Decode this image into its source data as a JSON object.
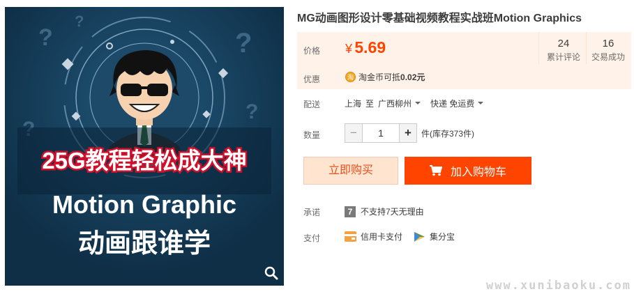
{
  "product": {
    "title": "MG动画图形设计零基础视频教程实战班Motion Graphics",
    "image": {
      "banner_text": "25G教程轻松成大神",
      "headline": "Motion Graphic",
      "subline": "动画跟谁学"
    }
  },
  "price_panel": {
    "label": "价格",
    "currency": "¥",
    "price": "5.69",
    "stats": [
      {
        "value": "24",
        "label": "累计评论"
      },
      {
        "value": "16",
        "label": "交易成功"
      }
    ],
    "promo_label": "优惠",
    "coin_icon_text": "淘",
    "promo_text": "淘金币可抵",
    "promo_amount": "0.02元"
  },
  "shipping": {
    "label": "配送",
    "from": "上海",
    "to_word": "至",
    "destination": "广西柳州",
    "method": "快递 免运费"
  },
  "quantity": {
    "label": "数量",
    "minus": "−",
    "value": "1",
    "plus": "+",
    "stock_text": "件(库存373件)"
  },
  "actions": {
    "buy_now": "立即购买",
    "add_to_cart": "加入购物车"
  },
  "promise": {
    "label": "承诺",
    "badge": "7",
    "text": "不支持7天无理由"
  },
  "payment": {
    "label": "支付",
    "methods": [
      "信用卡支付",
      "集分宝"
    ]
  },
  "watermark": "www.xunibaoku.com",
  "colors": {
    "accent": "#ff4400",
    "price_bg": "#fff2e8",
    "buy_now_bg": "#ffe4d0",
    "image_bg": "#143a55"
  }
}
